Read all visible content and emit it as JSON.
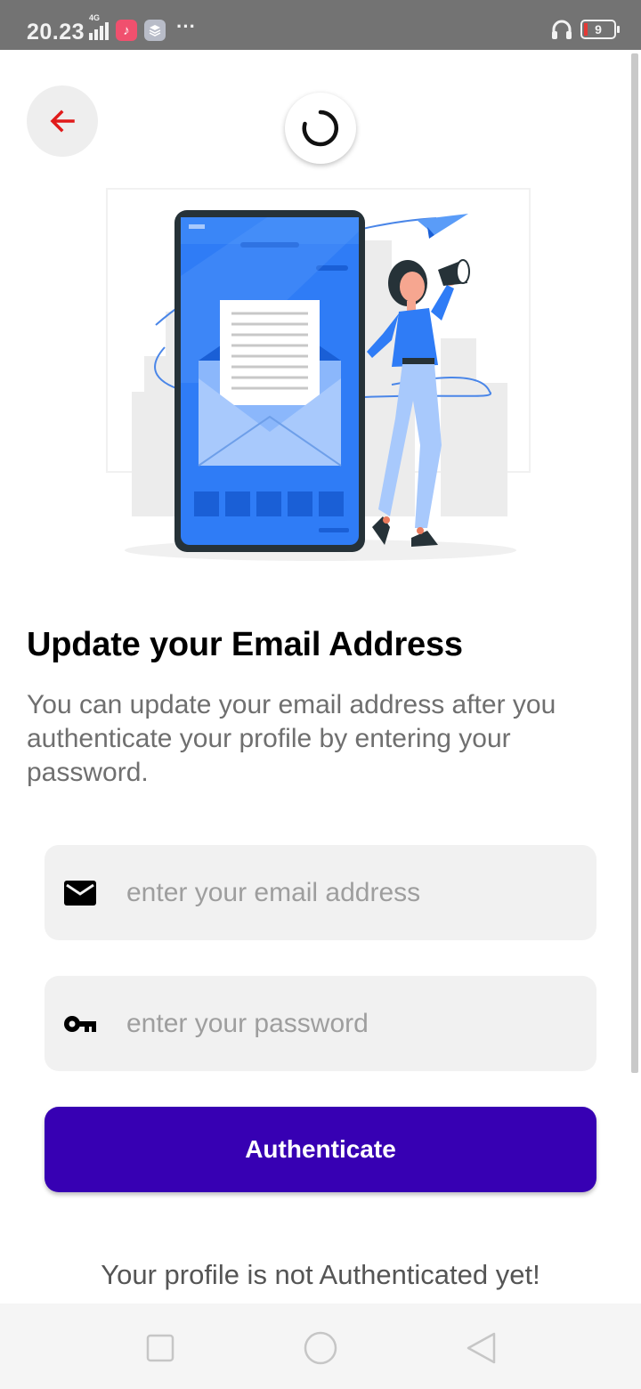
{
  "status_bar": {
    "time": "20.23",
    "network_label": "4G",
    "battery_level": "9",
    "overflow": "···",
    "icons": [
      "signal-icon",
      "music-app-icon",
      "layers-app-icon",
      "more-icon",
      "headphones-icon",
      "battery-icon"
    ]
  },
  "header": {
    "back_icon": "arrow-left-icon",
    "loading_icon": "spinner-icon"
  },
  "illustration": {
    "subject": "email-envelope-on-phone-with-woman-megaphone"
  },
  "content": {
    "title": "Update your Email Address",
    "description": "You can update your email address after you authenticate your profile by entering your password."
  },
  "form": {
    "email_placeholder": "enter your email address",
    "email_value": "",
    "email_icon": "mail-icon",
    "password_placeholder": "enter your password",
    "password_value": "",
    "password_icon": "key-icon",
    "submit_label": "Authenticate"
  },
  "status_message": "Your profile is not Authenticated yet!",
  "nav": {
    "items": [
      "recents-square-icon",
      "home-circle-icon",
      "back-triangle-icon"
    ]
  },
  "colors": {
    "accent": "#3700b3",
    "back_arrow": "#e01b1b",
    "illustration_blue": "#2f7cf6",
    "field_background": "#f1f1f1",
    "status_bar": "#737373"
  }
}
